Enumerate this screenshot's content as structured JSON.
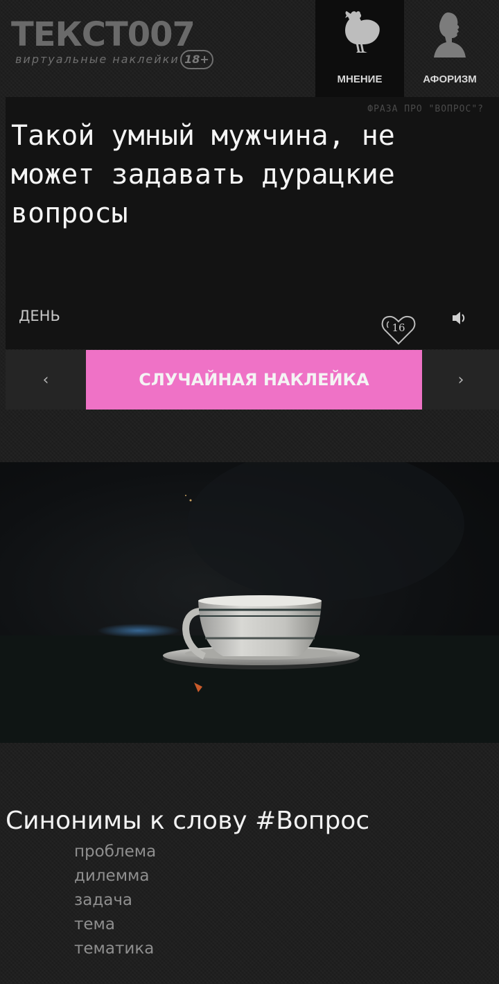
{
  "logo": {
    "title": "ТЕКСТ007",
    "subtitle": "виртуальные наклейки",
    "age": "18+"
  },
  "nav": {
    "tabs": [
      {
        "label": "МНЕНИЕ",
        "icon": "chicken-icon",
        "active": true
      },
      {
        "label": "АФОРИЗМ",
        "icon": "silhouette-bust-icon",
        "active": false
      }
    ]
  },
  "card": {
    "phrase_tag": "ФРАЗА ПРО \"ВОПРОС\"?",
    "quote": "Такой умный мужчина, не может задавать дурацкие вопросы",
    "day_label": "ДЕНЬ",
    "likes": "16",
    "like_icon": "heart-icon",
    "sound_icon": "speaker-icon"
  },
  "controls": {
    "prev": "‹",
    "next": "›",
    "random_label": "СЛУЧАЙНАЯ НАКЛЕЙКА",
    "random_color": "#ef72c6"
  },
  "photo": {
    "subject": "teacup-on-saucer-image"
  },
  "synonyms": {
    "title": "Синонимы к слову #Вопрос",
    "items": [
      "проблема",
      "дилемма",
      "задача",
      "тема",
      "тематика"
    ]
  }
}
